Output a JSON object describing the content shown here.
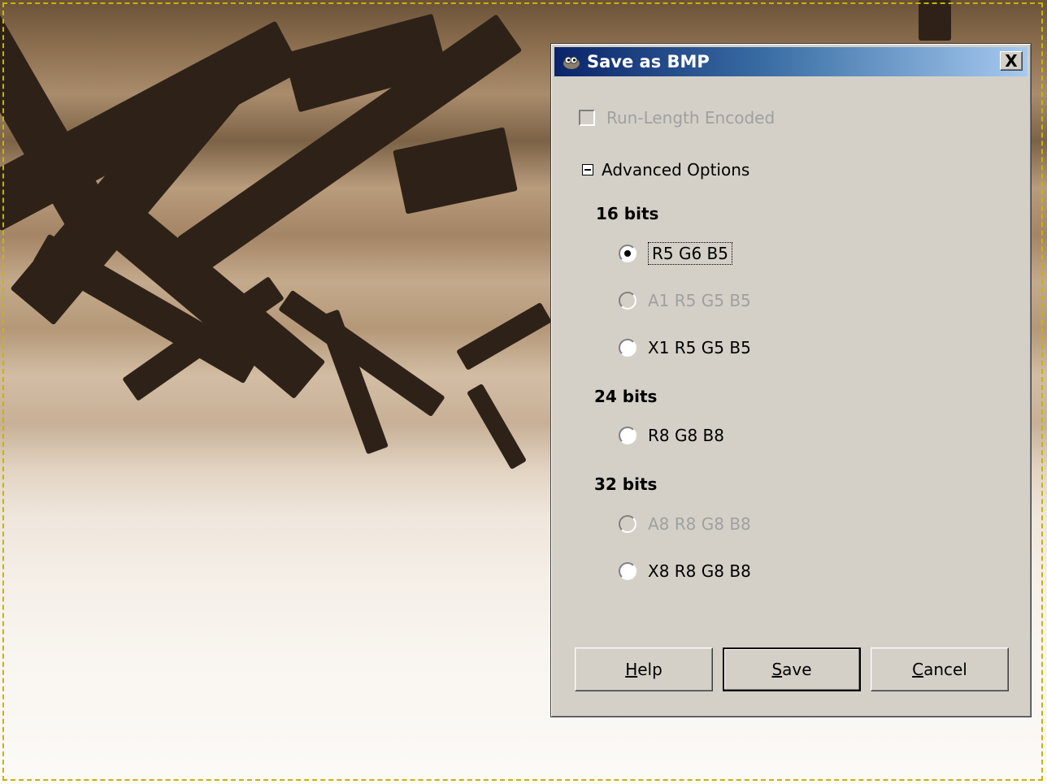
{
  "dialog": {
    "title": "Save as BMP",
    "close_glyph": "X",
    "rle_checkbox": {
      "label": "Run-Length Encoded",
      "checked": false,
      "enabled": false
    },
    "advanced_options": {
      "label": "Advanced Options",
      "expanded": true
    },
    "groups": [
      {
        "heading": "16 bits",
        "options": [
          {
            "label": "R5 G6 B5",
            "selected": true,
            "enabled": true
          },
          {
            "label": "A1 R5 G5 B5",
            "selected": false,
            "enabled": false
          },
          {
            "label": "X1 R5 G5 B5",
            "selected": false,
            "enabled": true
          }
        ]
      },
      {
        "heading": "24 bits",
        "options": [
          {
            "label": "R8 G8 B8",
            "selected": false,
            "enabled": true
          }
        ]
      },
      {
        "heading": "32 bits",
        "options": [
          {
            "label": "A8 R8 G8 B8",
            "selected": false,
            "enabled": false
          },
          {
            "label": "X8 R8 G8 B8",
            "selected": false,
            "enabled": true
          }
        ]
      }
    ],
    "buttons": {
      "help": {
        "mnemonic": "H",
        "rest": "elp"
      },
      "save": {
        "mnemonic": "S",
        "rest": "ave"
      },
      "cancel": {
        "mnemonic": "C",
        "rest": "ancel"
      }
    }
  },
  "colors": {
    "title_bar_start": "#0a246a",
    "title_bar_end": "#a6caf0",
    "dialog_face": "#d4d0c8",
    "highlight_box": "#e00000",
    "selection_marquee": "#c8b400"
  },
  "icons": {
    "title_icon": "gimp-wilber-icon",
    "close_icon": "close-x-icon"
  }
}
